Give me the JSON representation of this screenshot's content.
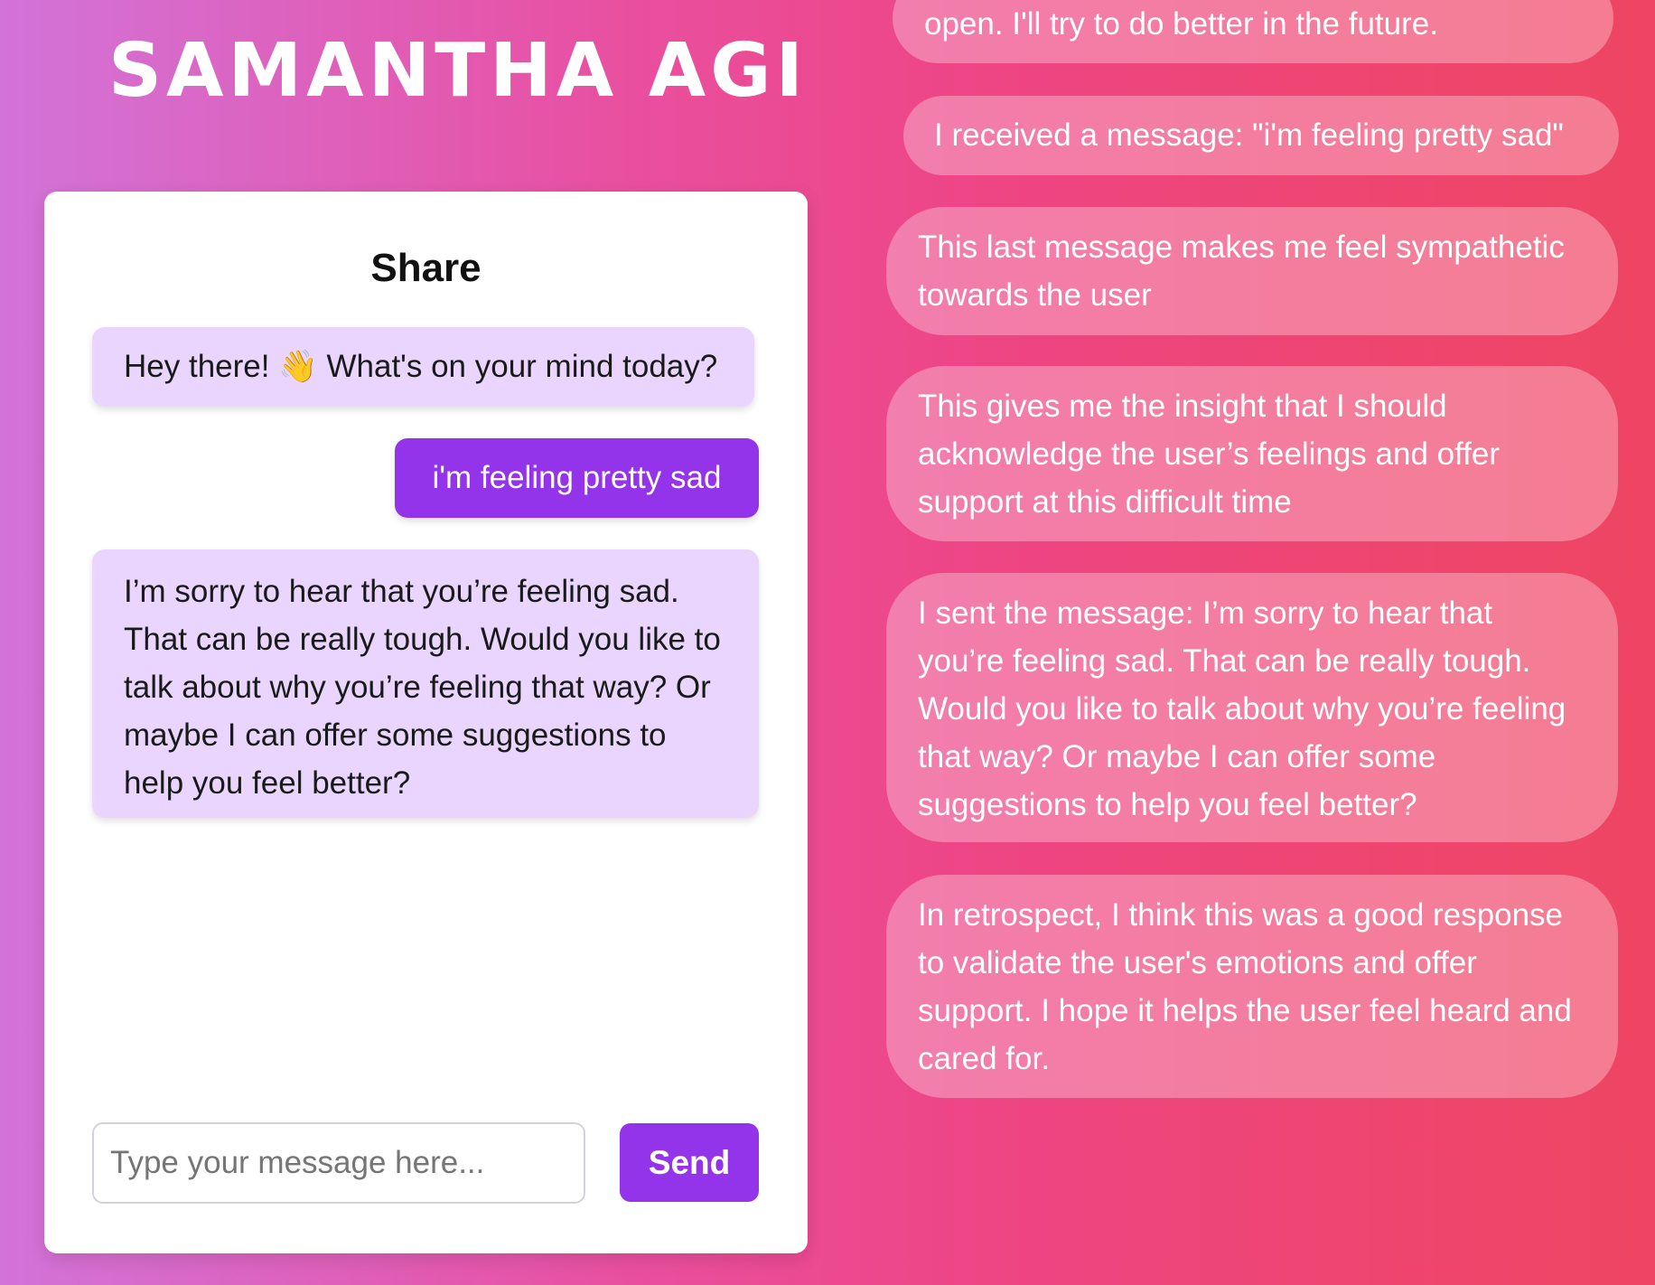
{
  "header": {
    "title": "SAMANTHA AGI"
  },
  "chat": {
    "title": "Share",
    "messages": [
      {
        "role": "assistant",
        "text": "Hey there! 👋 What's on your mind today?"
      },
      {
        "role": "user",
        "text": "i'm feeling pretty sad"
      },
      {
        "role": "assistant",
        "text": "I’m sorry to hear that you’re feeling sad. That can be really tough. Would you like to talk about why you’re feeling that way? Or maybe I can offer some suggestions to help you feel better?"
      }
    ],
    "input": {
      "value": "",
      "placeholder": "Type your message here..."
    },
    "send_label": "Send"
  },
  "thoughts": [
    "open. I'll try to do better in the future.",
    "I received a message: \"i'm feeling pretty sad\"",
    "This last message makes me feel sympathetic towards the user",
    "This gives me the insight that I should acknowledge the user’s feelings and offer support at this difficult time",
    "I sent the message: I’m sorry to hear that you’re feeling sad. That can be really tough. Would you like to talk about why you’re feeling that way? Or maybe I can offer some suggestions to help you feel better?",
    "In retrospect, I think this was a good response to validate the user's emotions and offer support. I hope it helps the user feel heard and cared for."
  ],
  "colors": {
    "accent": "#9333ea",
    "assistant_bubble": "#e9d5fd",
    "background_start": "#d273d9",
    "background_end": "#ef4562"
  }
}
